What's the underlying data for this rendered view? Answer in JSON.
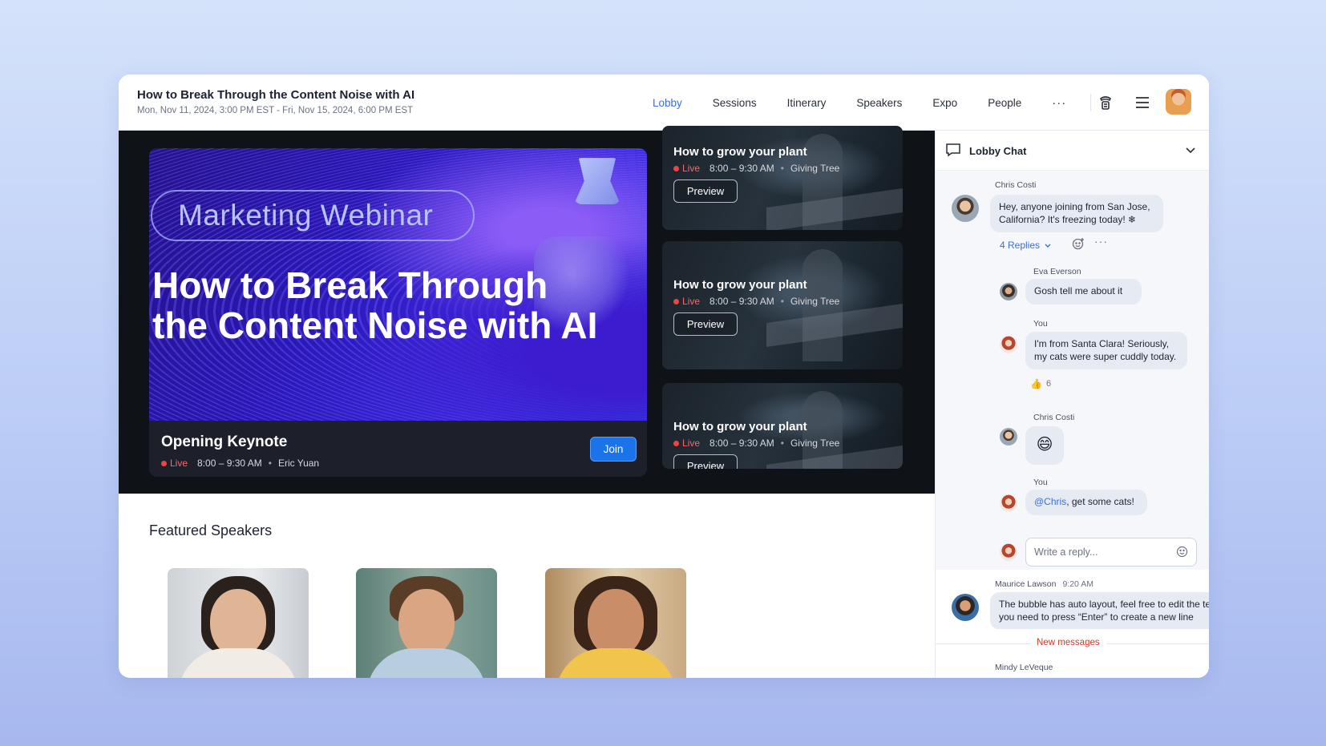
{
  "event": {
    "title": "How to Break Through the Content Noise with AI",
    "dates": "Mon, Nov 11, 2024, 3:00 PM EST - Fri, Nov 15, 2024, 6:00 PM EST"
  },
  "nav": {
    "items": [
      {
        "label": "Lobby",
        "active": true
      },
      {
        "label": "Sessions",
        "active": false
      },
      {
        "label": "Itinerary",
        "active": false
      },
      {
        "label": "Speakers",
        "active": false
      },
      {
        "label": "Expo",
        "active": false
      },
      {
        "label": "People",
        "active": false
      }
    ],
    "more": "···"
  },
  "keynote": {
    "banner_tag": "Marketing Webinar",
    "banner_headline": "How to Break Through the Content Noise with AI",
    "title": "Opening Keynote",
    "live": "Live",
    "time": "8:00 – 9:30 AM",
    "speaker": "Eric Yuan",
    "join_label": "Join"
  },
  "sessions": [
    {
      "title": "How to grow your plant",
      "live": "Live",
      "time": "8:00 – 9:30 AM",
      "host": "Giving Tree",
      "button": "Preview"
    },
    {
      "title": "How to grow your plant",
      "live": "Live",
      "time": "8:00 – 9:30 AM",
      "host": "Giving Tree",
      "button": "Preview"
    },
    {
      "title": "How to grow your plant",
      "live": "Live",
      "time": "8:00 – 9:30 AM",
      "host": "Giving Tree",
      "button": "Preview"
    }
  ],
  "featured": {
    "title": "Featured Speakers"
  },
  "chat": {
    "title": "Lobby Chat",
    "messages": {
      "m1": {
        "name": "Chris Costi",
        "text": "Hey, anyone joining from San Jose, California? It's freezing today! ❄"
      },
      "replies_label": "4 Replies",
      "r1": {
        "name": "Eva Everson",
        "text": "Gosh tell me about it"
      },
      "r2": {
        "name": "You",
        "text": "I'm from Santa Clara! Seriously, my cats were super cuddly today."
      },
      "r2_reaction_count": "6",
      "r3": {
        "name": "Chris Costi",
        "text": "😄"
      },
      "r4": {
        "name": "You",
        "mention": "@Chris",
        "text": ", get some cats!"
      },
      "reply_placeholder": "Write a reply...",
      "m2": {
        "name": "Maurice Lawson",
        "time": "9:20 AM",
        "text": "The bubble has auto layout, feel free to edit the text you need to press “Enter” to create a new line"
      },
      "new_messages": "New messages",
      "m3": {
        "name": "Mindy LeVeque"
      }
    }
  },
  "colors": {
    "accent": "#1a73e8",
    "nav_active": "#3a6fd8",
    "live": "#ef4444",
    "new_messages": "#d9362b"
  },
  "icons": [
    "handset-icon",
    "menu-icon",
    "chat-bubble-icon",
    "chevron-down-icon",
    "emoji-icon",
    "thumbs-up-icon",
    "more-icon"
  ]
}
